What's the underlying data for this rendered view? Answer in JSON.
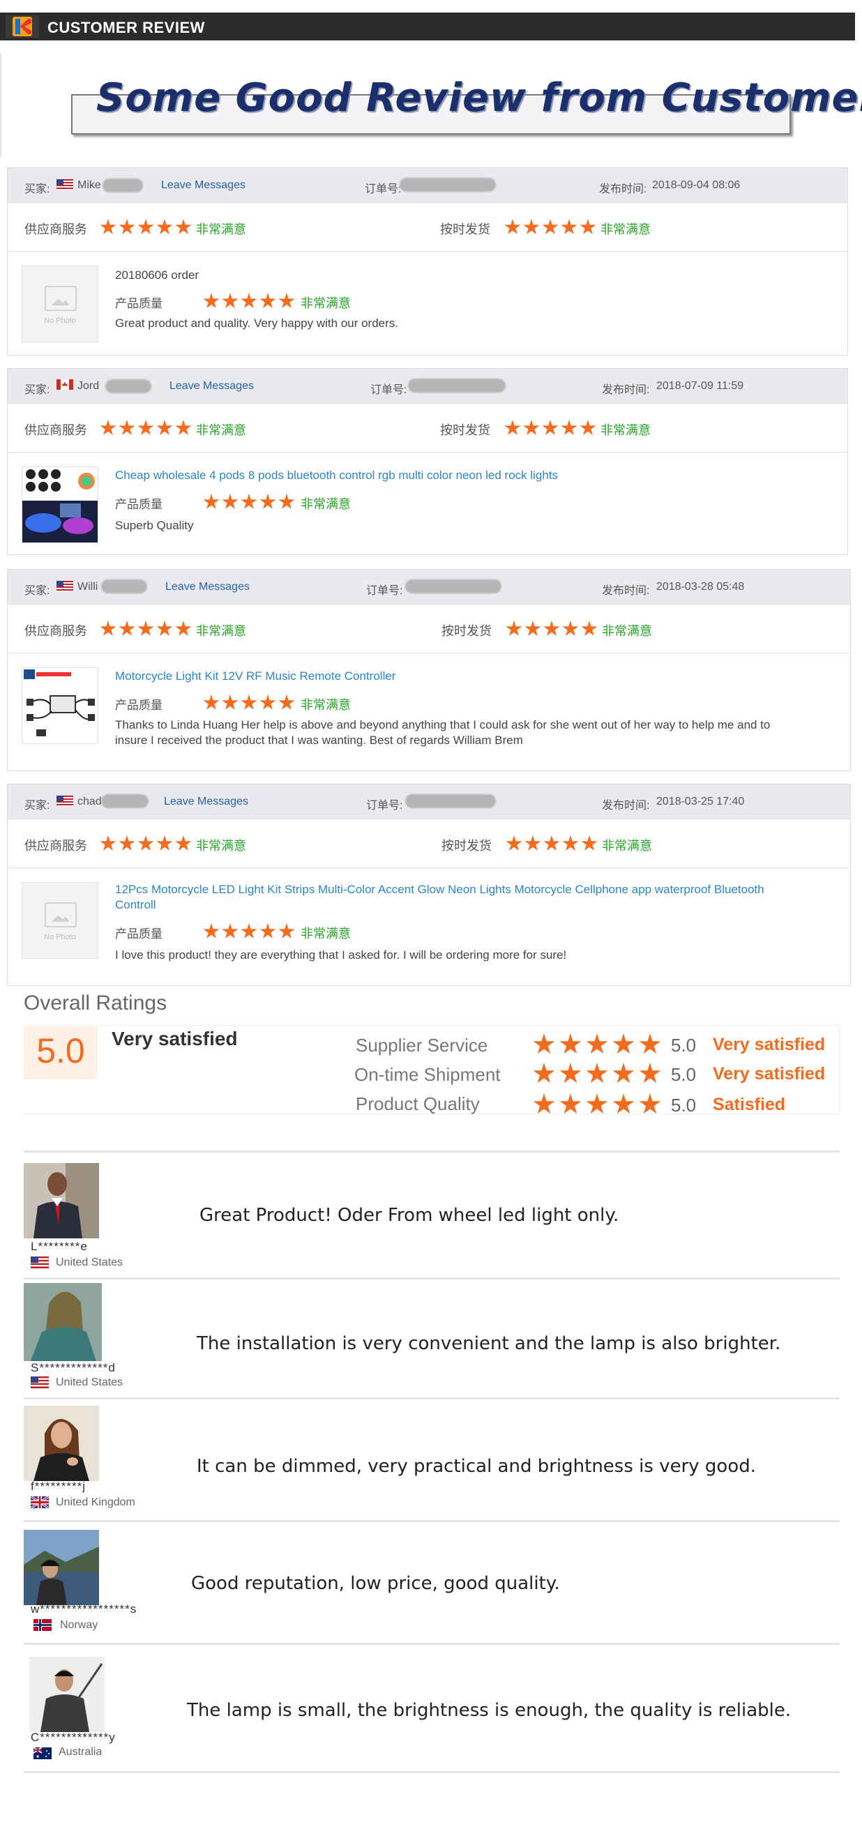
{
  "header": {
    "title": "CUSTOMER REVIEW"
  },
  "banner": {
    "title": "Some Good Review from Customers"
  },
  "labels": {
    "buyer": "买家:",
    "order": "订单号:",
    "published": "发布时间:",
    "supplier_service": "供应商服务",
    "on_time": "按时发货",
    "product_quality": "产品质量",
    "very_satisfied": "非常满意",
    "leave_messages": "Leave Messages",
    "no_photo": "No Photo"
  },
  "reviews": [
    {
      "buyer": "Mike",
      "flag": "US",
      "date": "2018-09-04 08:06",
      "product": "20180606 order",
      "product_is_link": false,
      "text": "Great product and quality. Very happy with our orders.",
      "image": "none"
    },
    {
      "buyer": "Jord",
      "flag": "CA",
      "date": "2018-07-09 11:59",
      "product": "Cheap wholesale 4 pods 8 pods bluetooth control rgb multi color neon led rock lights",
      "product_is_link": true,
      "text": "Superb Quality",
      "image": "rock-lights"
    },
    {
      "buyer": "Willi",
      "flag": "US",
      "date": "2018-03-28 05:48",
      "product": "Motorcycle Light Kit 12V RF Music Remote Controller",
      "product_is_link": true,
      "text": "Thanks to Linda Huang Her help is above and beyond anything that I could ask for she went out of her way to help me and to insure I received the product that I was wanting. Best of regards William Brem",
      "image": "motorcycle-kit"
    },
    {
      "buyer": "chad",
      "flag": "US",
      "date": "2018-03-25 17:40",
      "product": "12Pcs Motorcycle LED Light Kit Strips Multi-Color Accent Glow Neon Lights Motorcycle Cellphone app waterproof Bluetooth Controll",
      "product_is_link": true,
      "text": "I love this product! they are everything that I asked for. I will be ordering more for sure!",
      "image": "none"
    }
  ],
  "overall": {
    "title": "Overall Ratings",
    "score": "5.0",
    "summary": "Very satisfied",
    "rows": [
      {
        "label": "Supplier Service",
        "value": "5.0",
        "text": "Very satisfied"
      },
      {
        "label": "On-time Shipment",
        "value": "5.0",
        "text": "Very satisfied"
      },
      {
        "label": "Product Quality",
        "value": "5.0",
        "text": "Satisfied"
      }
    ]
  },
  "customers": [
    {
      "name": "L********e",
      "country": "United States",
      "flag": "US",
      "comment": "Great Product! Oder From wheel led light only."
    },
    {
      "name": "S*************d",
      "country": "United States",
      "flag": "US",
      "comment": "The installation is very convenient and the lamp is also brighter."
    },
    {
      "name": "f*********j",
      "country": "United Kingdom",
      "flag": "GB",
      "comment": "It can be dimmed, very practical and brightness is very good."
    },
    {
      "name": "w*****************s",
      "country": "Norway",
      "flag": "NO",
      "comment": "Good reputation, low price, good quality."
    },
    {
      "name": "C*************y",
      "country": "Australia",
      "flag": "AU",
      "comment": "The lamp is small, the brightness is enough, the quality is reliable."
    }
  ],
  "colors": {
    "accent": "#f36b1c",
    "green": "#2aa62a",
    "link": "#2a86c8",
    "banner": "#1a2f6b"
  }
}
